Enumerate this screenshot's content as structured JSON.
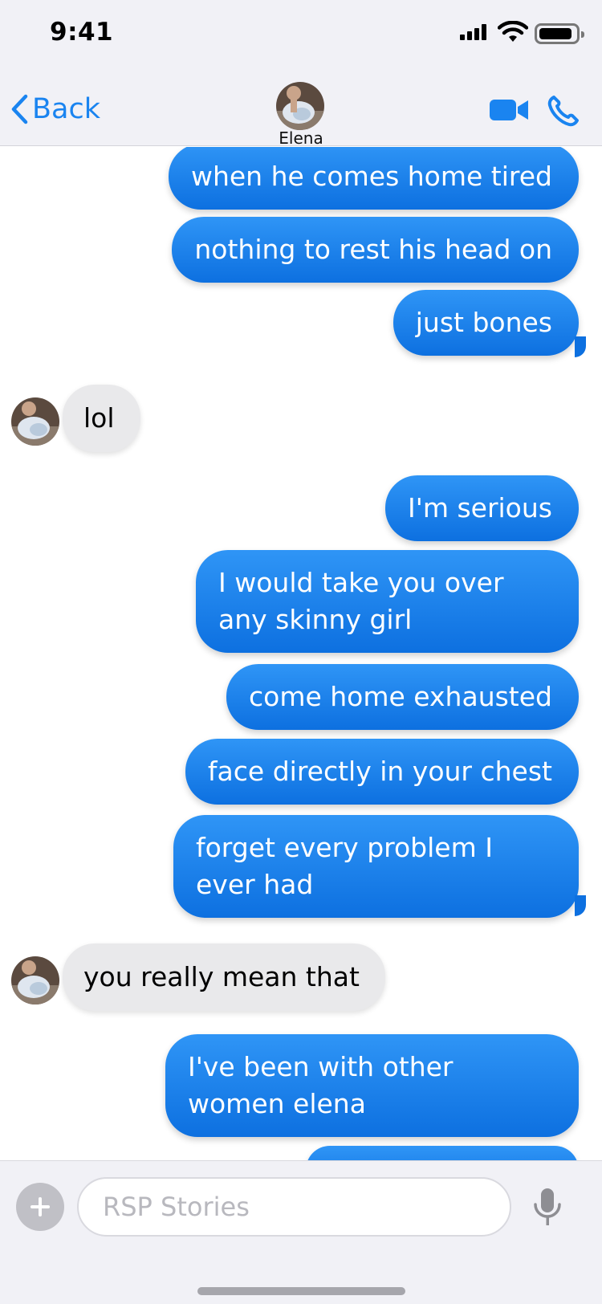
{
  "status_bar": {
    "time": "9:41"
  },
  "header": {
    "back_label": "Back",
    "contact_name": "Elena"
  },
  "messages": [
    {
      "from": "me",
      "text": "when he comes home tired"
    },
    {
      "from": "me",
      "text": "nothing to rest his head on"
    },
    {
      "from": "me",
      "text": "just bones"
    },
    {
      "from": "them",
      "text": "lol"
    },
    {
      "from": "me",
      "text": "I'm serious"
    },
    {
      "from": "me",
      "text": "I would take you over any skinny girl"
    },
    {
      "from": "me",
      "text": "come home exhausted"
    },
    {
      "from": "me",
      "text": "face directly in your chest"
    },
    {
      "from": "me",
      "text": "forget every problem I ever had"
    },
    {
      "from": "them",
      "text": "you really mean that"
    },
    {
      "from": "me",
      "text": "I've been with other women elena"
    }
  ],
  "composer": {
    "placeholder": "RSP Stories",
    "value": ""
  },
  "icons": {
    "back": "chevron-left-icon",
    "video": "video-camera-icon",
    "phone": "phone-icon",
    "add": "plus-icon",
    "mic": "microphone-icon"
  },
  "colors": {
    "accent": "#1a84f0",
    "outgoing_bubble": "#1a84f0",
    "incoming_bubble": "#e9e9eb",
    "bar_background": "#f1f1f6"
  }
}
